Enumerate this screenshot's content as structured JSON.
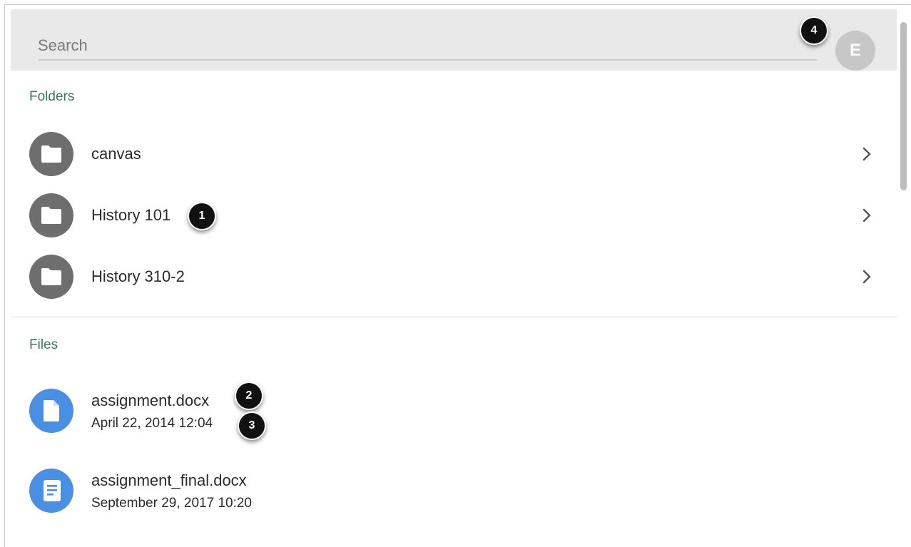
{
  "search": {
    "placeholder": "Search",
    "value": ""
  },
  "avatar": {
    "initial": "E"
  },
  "callouts": [
    "1",
    "2",
    "3",
    "4"
  ],
  "folders": {
    "label": "Folders",
    "items": [
      {
        "name": "canvas"
      },
      {
        "name": "History 101"
      },
      {
        "name": "History 310-2"
      }
    ]
  },
  "files": {
    "label": "Files",
    "items": [
      {
        "name": "assignment.docx",
        "date": "April 22, 2014 12:04"
      },
      {
        "name": "assignment_final.docx",
        "date": "September 29, 2017 10:20"
      }
    ]
  },
  "colors": {
    "header_bg": "#e9e9e9",
    "section_label": "#3b7a62",
    "folder_icon_bg": "#6e6e6e",
    "file_icon_bg": "#4a90e2",
    "avatar_bg": "#c7c7c7"
  },
  "icons": {
    "folder": "folder-icon",
    "file": "file-icon",
    "document": "document-icon",
    "chevron": "chevron-right-icon"
  }
}
